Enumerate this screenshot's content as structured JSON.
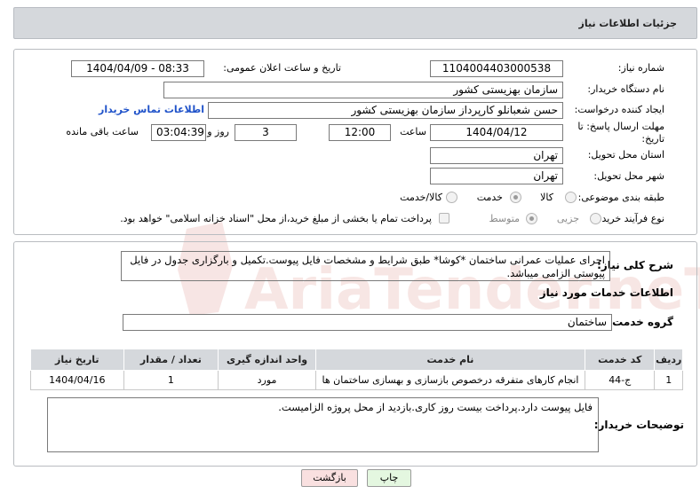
{
  "header": {
    "title": "جزئیات اطلاعات نیاز"
  },
  "form": {
    "need_number_label": "شماره نیاز:",
    "need_number": "1104004403000538",
    "announce_label": "تاریخ و ساعت اعلان عمومی:",
    "announce_value": "1404/04/09 - 08:33",
    "buyer_org_label": "نام دستگاه خریدار:",
    "buyer_org": "سازمان بهزیستی کشور",
    "requester_label": "ایجاد کننده درخواست:",
    "requester": "حسن  شعبانلو کارپرداز سازمان بهزیستی کشور",
    "contact_link": "اطلاعات تماس خریدار",
    "deadline_label_line1": "مهلت ارسال پاسخ: تا",
    "deadline_label_line2": "تاریخ:",
    "deadline_date": "1404/04/12",
    "time_label": "ساعت",
    "deadline_time": "12:00",
    "days_value": "3",
    "days_label": "روز و",
    "remaining_time": "03:04:39",
    "remaining_label": "ساعت باقی مانده",
    "province_label": "استان محل تحویل:",
    "province": "تهران",
    "city_label": "شهر محل تحویل:",
    "city": "تهران",
    "category_label": "طبقه بندی موضوعی:",
    "category_options": [
      "کالا",
      "خدمت",
      "کالا/خدمت"
    ],
    "category_selected": "خدمت",
    "process_label": "نوع فرآیند خرید :",
    "process_options": [
      "جزیی",
      "متوسط"
    ],
    "process_selected": "متوسط",
    "treasury_note": "پرداخت تمام یا بخشی از مبلغ خرید،از محل \"اسناد خزانه اسلامی\" خواهد بود."
  },
  "description": {
    "label": "شرح کلی نیاز:",
    "text": "اجرای عملیات عمرانی ساختمان *کوشا*  طبق شرایط و مشخصات فایل پیوست.تکمیل و بارگزاری جدول در فایل پیوستی الزامی میباشد."
  },
  "services": {
    "section_title": "اطلاعات خدمات مورد نیاز",
    "group_label": "گروه خدمت:",
    "group_value": "ساختمان",
    "columns": [
      "ردیف",
      "کد خدمت",
      "نام خدمت",
      "واحد اندازه گیری",
      "تعداد / مقدار",
      "تاریخ نیاز"
    ],
    "rows": [
      {
        "row": "1",
        "code": "ج-44",
        "name": "انجام کارهای متفرقه درخصوص بازسازی و بهسازی ساختمان ها",
        "unit": "مورد",
        "qty": "1",
        "date": "1404/04/16"
      }
    ]
  },
  "buyer_notes": {
    "label": "توضیحات خریدار:",
    "text": "فایل پیوست دارد.پرداخت بیست روز کاری.بازدید از محل پروژه الزامیست."
  },
  "buttons": {
    "print": "چاپ",
    "back": "بازگشت"
  },
  "watermark": {
    "text": "AriaTender.neT"
  }
}
